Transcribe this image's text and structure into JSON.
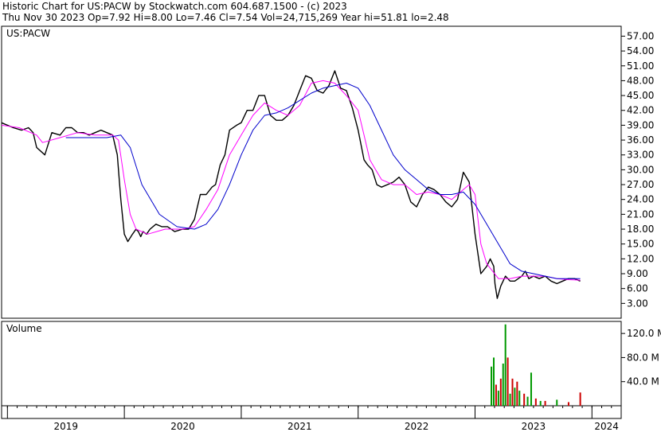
{
  "header": {
    "line1": "Historic Chart for US:PACW by Stockwatch.com 604.687.1500 - (c) 2023",
    "line2": "Thu Nov 30 2023  Op=7.92  Hi=8.00  Lo=7.46  Cl=7.54  Vol=24,715,269  Year hi=51.81  lo=2.48"
  },
  "colors": {
    "price": "#000000",
    "ma_short": "#ff00ff",
    "ma_long": "#0000cc",
    "vol_up": "#009900",
    "vol_down": "#cc0000"
  },
  "chart_data": [
    {
      "type": "line",
      "title": "US:PACW",
      "x_ticks": [
        "2019",
        "2020",
        "2021",
        "2022",
        "2023",
        "2024"
      ],
      "y_ticks": [
        "57.00",
        "54.00",
        "51.00",
        "48.00",
        "45.00",
        "42.00",
        "39.00",
        "36.00",
        "33.00",
        "30.00",
        "27.00",
        "24.00",
        "21.00",
        "18.00",
        "15.00",
        "12.00",
        "9.00",
        "6.00",
        "3.00"
      ],
      "ylim": [
        0,
        59
      ],
      "grid": false,
      "series": [
        {
          "role": "close",
          "x": [
            2018.95,
            2019.05,
            2019.12,
            2019.18,
            2019.22,
            2019.25,
            2019.32,
            2019.38,
            2019.45,
            2019.5,
            2019.55,
            2019.6,
            2019.65,
            2019.7,
            2019.75,
            2019.8,
            2019.85,
            2019.9,
            2019.94,
            2019.97,
            2020.0,
            2020.03,
            2020.07,
            2020.1,
            2020.12,
            2020.14,
            2020.16,
            2020.19,
            2020.22,
            2020.27,
            2020.32,
            2020.37,
            2020.43,
            2020.5,
            2020.55,
            2020.6,
            2020.65,
            2020.7,
            2020.75,
            2020.78,
            2020.82,
            2020.86,
            2020.9,
            2020.96,
            2021.0,
            2021.05,
            2021.1,
            2021.15,
            2021.2,
            2021.25,
            2021.3,
            2021.35,
            2021.4,
            2021.45,
            2021.5,
            2021.55,
            2021.6,
            2021.65,
            2021.7,
            2021.75,
            2021.8,
            2021.85,
            2021.9,
            2021.95,
            2022.0,
            2022.05,
            2022.08,
            2022.12,
            2022.16,
            2022.2,
            2022.25,
            2022.3,
            2022.35,
            2022.4,
            2022.45,
            2022.5,
            2022.55,
            2022.6,
            2022.65,
            2022.7,
            2022.75,
            2022.8,
            2022.85,
            2022.9,
            2022.95,
            2023.0,
            2023.05,
            2023.1,
            2023.13,
            2023.16,
            2023.17,
            2023.19,
            2023.22,
            2023.26,
            2023.3,
            2023.34,
            2023.37,
            2023.4,
            2023.43,
            2023.46,
            2023.5,
            2023.55,
            2023.6,
            2023.65,
            2023.7,
            2023.75,
            2023.8,
            2023.85,
            2023.9
          ],
          "y": [
            39.5,
            38.5,
            38.0,
            38.5,
            37.5,
            34.5,
            33.0,
            37.5,
            37.0,
            38.5,
            38.5,
            37.5,
            37.5,
            37.0,
            37.5,
            38.0,
            37.5,
            37.0,
            33.0,
            24.0,
            17.0,
            15.5,
            17.0,
            18.0,
            17.5,
            16.5,
            17.5,
            17.0,
            18.0,
            19.0,
            18.5,
            18.5,
            17.5,
            18.0,
            18.0,
            20.0,
            25.0,
            25.0,
            26.5,
            27.0,
            31.0,
            33.0,
            38.0,
            39.0,
            39.5,
            42.0,
            42.0,
            45.0,
            45.0,
            41.0,
            40.0,
            40.0,
            41.0,
            43.0,
            46.0,
            49.0,
            48.5,
            46.0,
            45.5,
            47.0,
            50.0,
            46.5,
            46.0,
            42.5,
            38.0,
            32.0,
            31.0,
            30.0,
            27.0,
            26.5,
            27.0,
            27.5,
            28.5,
            27.0,
            23.5,
            22.5,
            25.0,
            26.5,
            26.0,
            25.0,
            23.5,
            22.5,
            24.0,
            29.5,
            27.5,
            17.0,
            9.0,
            10.5,
            12.0,
            10.5,
            7.0,
            4.0,
            6.5,
            8.5,
            7.5,
            7.5,
            8.0,
            8.5,
            9.5,
            8.0,
            8.5,
            8.0,
            8.5,
            7.5,
            7.0,
            7.5,
            8.0,
            8.0,
            7.5
          ]
        },
        {
          "role": "short-moving-average",
          "x": [
            2018.95,
            2019.1,
            2019.25,
            2019.3,
            2019.45,
            2019.6,
            2019.75,
            2019.9,
            2019.95,
            2020.0,
            2020.05,
            2020.1,
            2020.2,
            2020.35,
            2020.5,
            2020.6,
            2020.7,
            2020.8,
            2020.9,
            2021.0,
            2021.1,
            2021.2,
            2021.3,
            2021.4,
            2021.5,
            2021.6,
            2021.7,
            2021.8,
            2021.9,
            2022.0,
            2022.05,
            2022.1,
            2022.15,
            2022.2,
            2022.3,
            2022.4,
            2022.5,
            2022.6,
            2022.7,
            2022.8,
            2022.9,
            2022.95,
            2023.0,
            2023.05,
            2023.1,
            2023.2,
            2023.3,
            2023.4,
            2023.5,
            2023.6,
            2023.7,
            2023.8,
            2023.9
          ],
          "y": [
            39.0,
            38.5,
            37.0,
            35.5,
            36.5,
            37.5,
            37.0,
            37.0,
            36.0,
            28.0,
            21.0,
            18.0,
            17.0,
            18.0,
            18.0,
            18.5,
            22.0,
            26.0,
            33.0,
            37.0,
            41.0,
            43.5,
            42.0,
            41.0,
            43.0,
            47.5,
            48.0,
            47.5,
            45.0,
            42.0,
            37.0,
            32.0,
            30.0,
            28.0,
            27.0,
            27.0,
            25.0,
            25.5,
            25.0,
            24.0,
            26.0,
            27.0,
            25.0,
            15.0,
            11.0,
            8.0,
            8.0,
            8.5,
            8.5,
            8.5,
            8.0,
            7.8,
            7.7
          ]
        },
        {
          "role": "long-moving-average",
          "x": [
            2019.5,
            2019.7,
            2019.85,
            2019.97,
            2020.05,
            2020.15,
            2020.3,
            2020.45,
            2020.6,
            2020.7,
            2020.8,
            2020.9,
            2021.0,
            2021.1,
            2021.2,
            2021.3,
            2021.4,
            2021.5,
            2021.6,
            2021.7,
            2021.8,
            2021.9,
            2022.0,
            2022.1,
            2022.2,
            2022.3,
            2022.4,
            2022.5,
            2022.6,
            2022.7,
            2022.8,
            2022.9,
            2023.0,
            2023.1,
            2023.2,
            2023.3,
            2023.4,
            2023.5,
            2023.6,
            2023.7,
            2023.8,
            2023.9
          ],
          "y": [
            36.5,
            36.5,
            36.5,
            37.0,
            34.5,
            27.0,
            21.0,
            18.5,
            18.0,
            19.0,
            22.0,
            27.0,
            33.0,
            38.0,
            41.0,
            41.5,
            42.5,
            44.0,
            45.5,
            46.5,
            47.0,
            47.5,
            46.5,
            43.0,
            38.0,
            33.0,
            30.0,
            28.0,
            26.0,
            25.0,
            25.0,
            25.5,
            23.0,
            19.0,
            15.0,
            11.0,
            9.5,
            9.0,
            8.5,
            8.0,
            8.0,
            8.0
          ]
        }
      ]
    },
    {
      "type": "bar",
      "title": "Volume",
      "y_ticks": [
        "120.0 M",
        "80.0 M",
        "40.0 M"
      ],
      "ylim": [
        0,
        140
      ],
      "x": [
        2023.14,
        2023.16,
        2023.18,
        2023.2,
        2023.22,
        2023.24,
        2023.26,
        2023.28,
        2023.3,
        2023.32,
        2023.34,
        2023.36,
        2023.38,
        2023.42,
        2023.45,
        2023.48,
        2023.52,
        2023.56,
        2023.6,
        2023.7,
        2023.8,
        2023.9
      ],
      "values": [
        65,
        80,
        35,
        25,
        45,
        70,
        135,
        80,
        20,
        45,
        30,
        40,
        25,
        20,
        15,
        55,
        12,
        8,
        8,
        10,
        6,
        22
      ],
      "up": [
        true,
        true,
        false,
        true,
        false,
        true,
        true,
        false,
        true,
        false,
        true,
        false,
        true,
        false,
        true,
        true,
        false,
        true,
        false,
        true,
        false,
        false
      ]
    }
  ]
}
